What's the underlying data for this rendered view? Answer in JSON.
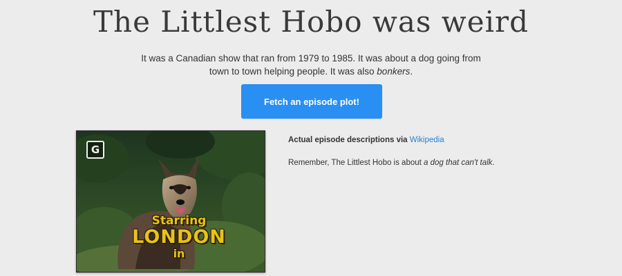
{
  "header": {
    "title": "The Littlest Hobo was weird"
  },
  "intro": {
    "text": "It was a Canadian show that ran from 1979 to 1985. It was about a dog going from town to town helping people. It was also ",
    "emphasis": "bonkers",
    "end": "."
  },
  "fetch_button": {
    "label": "Fetch an episode plot!",
    "color": "#2a8ff2"
  },
  "episode_still": {
    "logo_glyph": "G",
    "caption_line1": "Starring",
    "caption_line2": "LONDON",
    "caption_line3": "in",
    "caption_color": "#e8c21a"
  },
  "source": {
    "lead": "Actual episode descriptions via ",
    "link_label": "Wikipedia",
    "link_color": "#2a7fd4"
  },
  "reminder": {
    "text": "Remember, The Littlest Hobo is about ",
    "emphasis": "a dog that can't talk",
    "end": "."
  }
}
